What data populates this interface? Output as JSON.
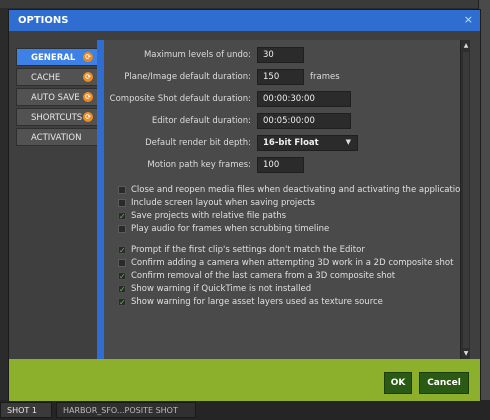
{
  "dialog": {
    "title": "OPTIONS",
    "close_glyph": "×"
  },
  "sidebar": {
    "items": [
      {
        "label": "GENERAL",
        "active": true,
        "has_arrow": true
      },
      {
        "label": "CACHE",
        "active": false,
        "has_arrow": true
      },
      {
        "label": "AUTO SAVE",
        "active": false,
        "has_arrow": true
      },
      {
        "label": "SHORTCUTS",
        "active": false,
        "has_arrow": true
      },
      {
        "label": "ACTIVATION",
        "active": false,
        "has_arrow": false
      }
    ],
    "arrow_glyph": "⟳"
  },
  "general": {
    "fields": [
      {
        "label": "Maximum levels of undo:",
        "value": "30",
        "unit": ""
      },
      {
        "label": "Plane/Image default duration:",
        "value": "150",
        "unit": "frames"
      },
      {
        "label": "Composite Shot default duration:",
        "value": "00:00:30:00",
        "unit": ""
      },
      {
        "label": "Editor default duration:",
        "value": "00:05:00:00",
        "unit": ""
      },
      {
        "label": "Default render bit depth:",
        "value": "16-bit Float",
        "unit": ""
      },
      {
        "label": "Motion path key frames:",
        "value": "100",
        "unit": ""
      }
    ],
    "checkboxes_group1": [
      {
        "label": "Close and reopen media files when deactivating and activating the application",
        "checked": false
      },
      {
        "label": "Include screen layout when saving projects",
        "checked": false
      },
      {
        "label": "Save projects with relative file paths",
        "checked": true
      },
      {
        "label": "Play audio for frames when scrubbing timeline",
        "checked": false
      }
    ],
    "checkboxes_group2": [
      {
        "label": "Prompt if the first clip's settings don't match the Editor",
        "checked": true
      },
      {
        "label": "Confirm adding a camera when attempting 3D work in a 2D composite shot",
        "checked": false
      },
      {
        "label": "Confirm removal of the last camera from a 3D composite shot",
        "checked": true
      },
      {
        "label": "Show warning if QuickTime is not installed",
        "checked": true
      },
      {
        "label": "Show warning for large asset layers used as texture source",
        "checked": true
      }
    ]
  },
  "footer": {
    "ok_label": "OK",
    "cancel_label": "Cancel"
  },
  "background": {
    "tab1": "SHOT 1",
    "tab2": "HARBOR_SFO...POSITE SHOT"
  },
  "colors": {
    "accent_blue": "#2f6ed0",
    "active_tab": "#3d80e6",
    "footer_green": "#8cb02b",
    "button_green": "#2a5a14",
    "checkmark": "#5bc24a",
    "arrow_orange": "#f08a1c"
  }
}
